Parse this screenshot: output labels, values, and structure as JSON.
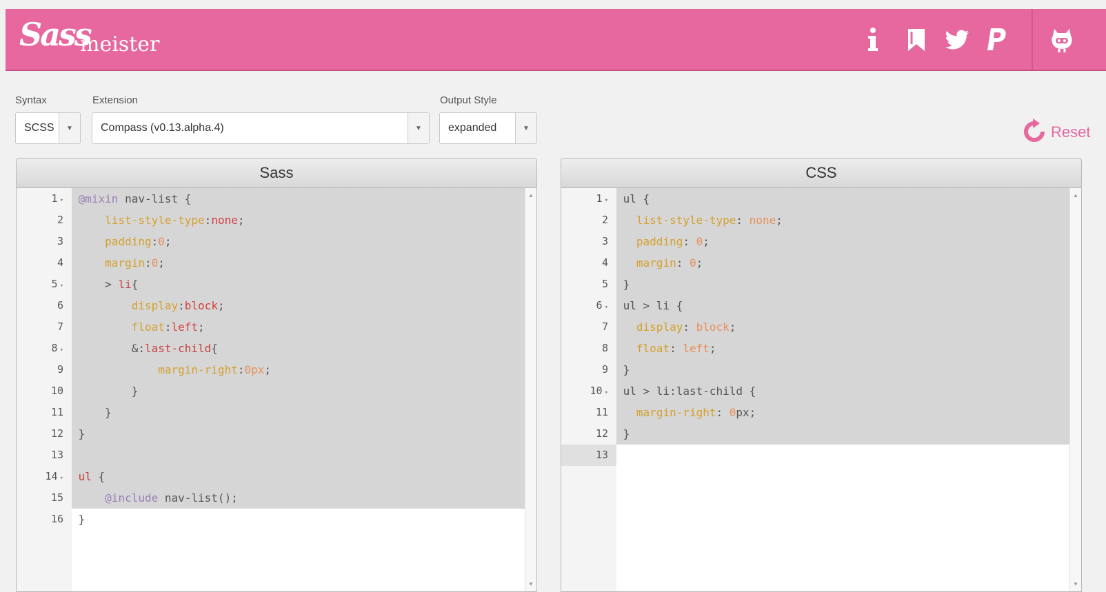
{
  "app": {
    "logo_script": "Sass",
    "logo_rest": "meister"
  },
  "header_icons": [
    "info-icon",
    "bookmark-icon",
    "twitter-icon",
    "paypal-icon",
    "github-icon"
  ],
  "controls": {
    "syntax_label": "Syntax",
    "syntax_value": "SCSS",
    "extension_label": "Extension",
    "extension_value": "Compass  (v0.13.alpha.4)",
    "output_label": "Output Style",
    "output_value": "expanded",
    "reset_label": "Reset"
  },
  "sass_panel": {
    "title": "Sass",
    "lines": [
      {
        "n": "1",
        "fold": true,
        "text": "@mixin nav-list {"
      },
      {
        "n": "2",
        "fold": false,
        "text": "    list-style-type:none;"
      },
      {
        "n": "3",
        "fold": false,
        "text": "    padding:0;"
      },
      {
        "n": "4",
        "fold": false,
        "text": "    margin:0;"
      },
      {
        "n": "5",
        "fold": true,
        "text": "    > li{"
      },
      {
        "n": "6",
        "fold": false,
        "text": "        display:block;"
      },
      {
        "n": "7",
        "fold": false,
        "text": "        float:left;"
      },
      {
        "n": "8",
        "fold": true,
        "text": "        &:last-child{"
      },
      {
        "n": "9",
        "fold": false,
        "text": "            margin-right:0px;"
      },
      {
        "n": "10",
        "fold": false,
        "text": "        }"
      },
      {
        "n": "11",
        "fold": false,
        "text": "    }"
      },
      {
        "n": "12",
        "fold": false,
        "text": "}"
      },
      {
        "n": "13",
        "fold": false,
        "text": ""
      },
      {
        "n": "14",
        "fold": true,
        "text": "ul {"
      },
      {
        "n": "15",
        "fold": false,
        "text": "    @include nav-list();"
      },
      {
        "n": "16",
        "fold": false,
        "text": "}"
      }
    ]
  },
  "css_panel": {
    "title": "CSS",
    "lines": [
      {
        "n": "1",
        "fold": true,
        "text": "ul {"
      },
      {
        "n": "2",
        "fold": false,
        "text": "  list-style-type: none;"
      },
      {
        "n": "3",
        "fold": false,
        "text": "  padding: 0;"
      },
      {
        "n": "4",
        "fold": false,
        "text": "  margin: 0;"
      },
      {
        "n": "5",
        "fold": false,
        "text": "}"
      },
      {
        "n": "6",
        "fold": true,
        "text": "ul > li {"
      },
      {
        "n": "7",
        "fold": false,
        "text": "  display: block;"
      },
      {
        "n": "8",
        "fold": false,
        "text": "  float: left;"
      },
      {
        "n": "9",
        "fold": false,
        "text": "}"
      },
      {
        "n": "10",
        "fold": true,
        "text": "ul > li:last-child {"
      },
      {
        "n": "11",
        "fold": false,
        "text": "  margin-right: 0px;"
      },
      {
        "n": "12",
        "fold": false,
        "text": "}"
      },
      {
        "n": "13",
        "fold": false,
        "text": ""
      }
    ]
  },
  "colors": {
    "brand": "#e6689f",
    "selection": "#d6d6d6"
  }
}
